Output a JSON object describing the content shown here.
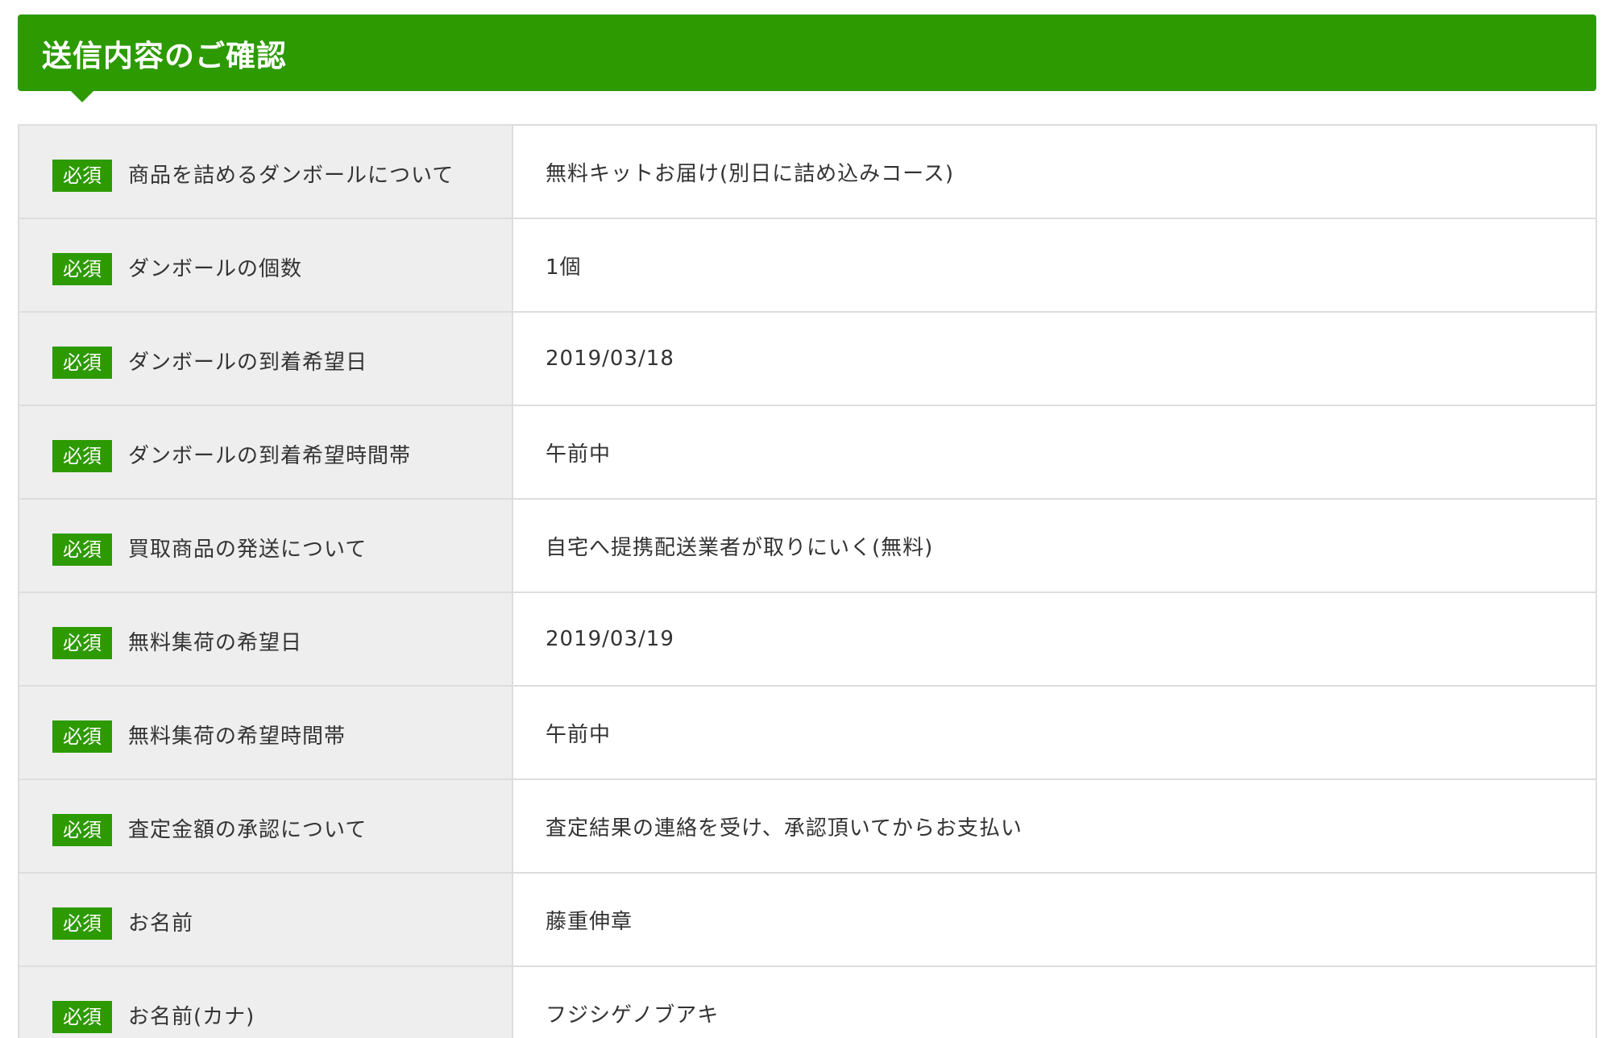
{
  "header": {
    "title": "送信内容のご確認"
  },
  "required_label": "必須",
  "rows": [
    {
      "label": "商品を詰めるダンボールについて",
      "value": "無料キットお届け(別日に詰め込みコース)"
    },
    {
      "label": "ダンボールの個数",
      "value": "1個"
    },
    {
      "label": "ダンボールの到着希望日",
      "value": "2019/03/18"
    },
    {
      "label": "ダンボールの到着希望時間帯",
      "value": "午前中"
    },
    {
      "label": "買取商品の発送について",
      "value": "自宅へ提携配送業者が取りにいく(無料)"
    },
    {
      "label": "無料集荷の希望日",
      "value": "2019/03/19"
    },
    {
      "label": "無料集荷の希望時間帯",
      "value": "午前中"
    },
    {
      "label": "査定金額の承認について",
      "value": "査定結果の連絡を受け、承認頂いてからお支払い"
    },
    {
      "label": "お名前",
      "value": "藤重伸章"
    },
    {
      "label": "お名前(カナ)",
      "value": "フジシゲノブアキ"
    }
  ],
  "colors": {
    "accent": "#2c9a00",
    "label_bg": "#eeeeee",
    "border": "#dddddd",
    "text": "#333333"
  }
}
